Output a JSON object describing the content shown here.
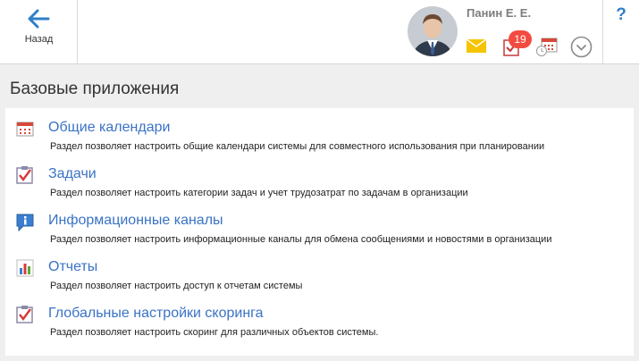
{
  "header": {
    "back_label": "Назад",
    "user_name": "Панин Е. Е.",
    "tasks_badge": "19",
    "help_label": "?"
  },
  "main": {
    "section_title": "Базовые приложения",
    "items": [
      {
        "title": "Общие календари",
        "description": "Раздел позволяет настроить общие календари системы для совместного использования при планировании",
        "icon": "calendar-icon"
      },
      {
        "title": "Задачи",
        "description": "Раздел позволяет настроить категории задач и учет трудозатрат по задачам в организации",
        "icon": "task-check-icon"
      },
      {
        "title": "Информационные каналы",
        "description": "Раздел позволяет настроить информационные каналы для обмена сообщениями и новостями в организации",
        "icon": "info-icon"
      },
      {
        "title": "Отчеты",
        "description": "Раздел позволяет настроить доступ к отчетам системы",
        "icon": "bar-chart-icon"
      },
      {
        "title": "Глобальные настройки скоринга",
        "description": "Раздел позволяет настроить скоринг для различных объектов системы.",
        "icon": "task-check-icon"
      }
    ]
  },
  "colors": {
    "accent": "#3a73c4",
    "badge": "#f24b3f",
    "mail": "#f5c400"
  }
}
